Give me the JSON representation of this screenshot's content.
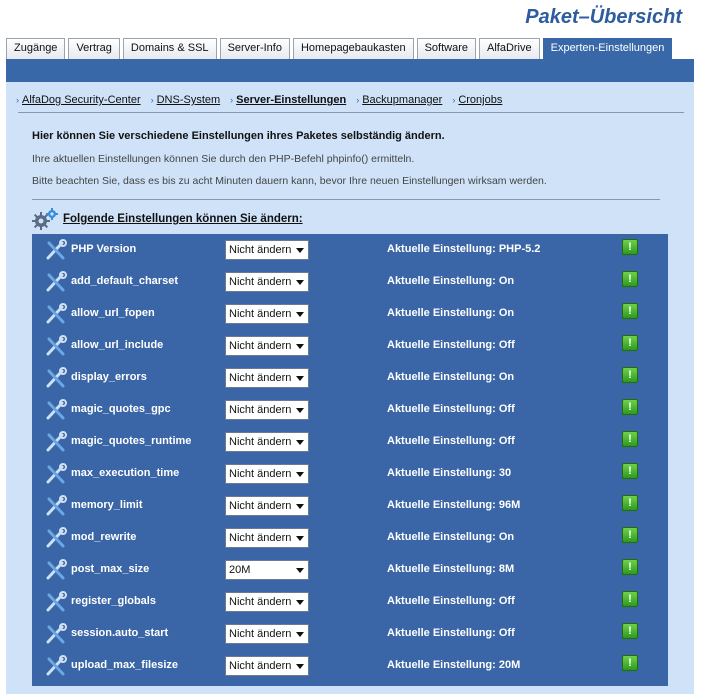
{
  "page_title": "Paket–Übersicht",
  "tabs": [
    {
      "label": "Zugänge",
      "active": false
    },
    {
      "label": "Vertrag",
      "active": false
    },
    {
      "label": "Domains & SSL",
      "active": false
    },
    {
      "label": "Server-Info",
      "active": false
    },
    {
      "label": "Homepagebaukasten",
      "active": false
    },
    {
      "label": "Software",
      "active": false
    },
    {
      "label": "AlfaDrive",
      "active": false
    },
    {
      "label": "Experten-Einstellungen",
      "active": true
    }
  ],
  "subnav": [
    {
      "label": "AlfaDog Security-Center",
      "active": false
    },
    {
      "label": "DNS-System",
      "active": false
    },
    {
      "label": "Server-Einstellungen",
      "active": true
    },
    {
      "label": "Backupmanager",
      "active": false
    },
    {
      "label": "Cronjobs",
      "active": false
    }
  ],
  "intro": {
    "heading": "Hier können Sie verschiedene Einstellungen ihres Paketes selbständig ändern.",
    "line1": "Ihre aktuellen Einstellungen können Sie durch den PHP-Befehl phpinfo() ermitteln.",
    "line2": "Bitte beachten Sie, dass es bis zu acht Minuten dauern kann, bevor Ihre neuen Einstellungen wirksam werden."
  },
  "section": {
    "title": "Folgende Einstellungen können Sie ändern:",
    "icon": "gears-icon"
  },
  "settings": [
    {
      "name": "PHP Version",
      "select": "Nicht ändern",
      "current": "Aktuelle Einstellung: PHP-5.2"
    },
    {
      "name": "add_default_charset",
      "select": "Nicht ändern",
      "current": "Aktuelle Einstellung: On"
    },
    {
      "name": "allow_url_fopen",
      "select": "Nicht ändern",
      "current": "Aktuelle Einstellung: On"
    },
    {
      "name": "allow_url_include",
      "select": "Nicht ändern",
      "current": "Aktuelle Einstellung: Off"
    },
    {
      "name": "display_errors",
      "select": "Nicht ändern",
      "current": "Aktuelle Einstellung: On"
    },
    {
      "name": "magic_quotes_gpc",
      "select": "Nicht ändern",
      "current": "Aktuelle Einstellung: Off"
    },
    {
      "name": "magic_quotes_runtime",
      "select": "Nicht ändern",
      "current": "Aktuelle Einstellung: Off"
    },
    {
      "name": "max_execution_time",
      "select": "Nicht ändern",
      "current": "Aktuelle Einstellung: 30"
    },
    {
      "name": "memory_limit",
      "select": "Nicht ändern",
      "current": "Aktuelle Einstellung: 96M"
    },
    {
      "name": "mod_rewrite",
      "select": "Nicht ändern",
      "current": "Aktuelle Einstellung: On"
    },
    {
      "name": "post_max_size",
      "select": "20M",
      "current": "Aktuelle Einstellung: 8M"
    },
    {
      "name": "register_globals",
      "select": "Nicht ändern",
      "current": "Aktuelle Einstellung: Off"
    },
    {
      "name": "session.auto_start",
      "select": "Nicht ändern",
      "current": "Aktuelle Einstellung: Off"
    },
    {
      "name": "upload_max_filesize",
      "select": "Nicht ändern",
      "current": "Aktuelle Einstellung: 20M"
    }
  ],
  "info_glyph": "!",
  "colors": {
    "accent": "#3868a8",
    "panel": "#cfe2f8",
    "title": "#2d5d9f",
    "info_green": "#3fae2a"
  }
}
